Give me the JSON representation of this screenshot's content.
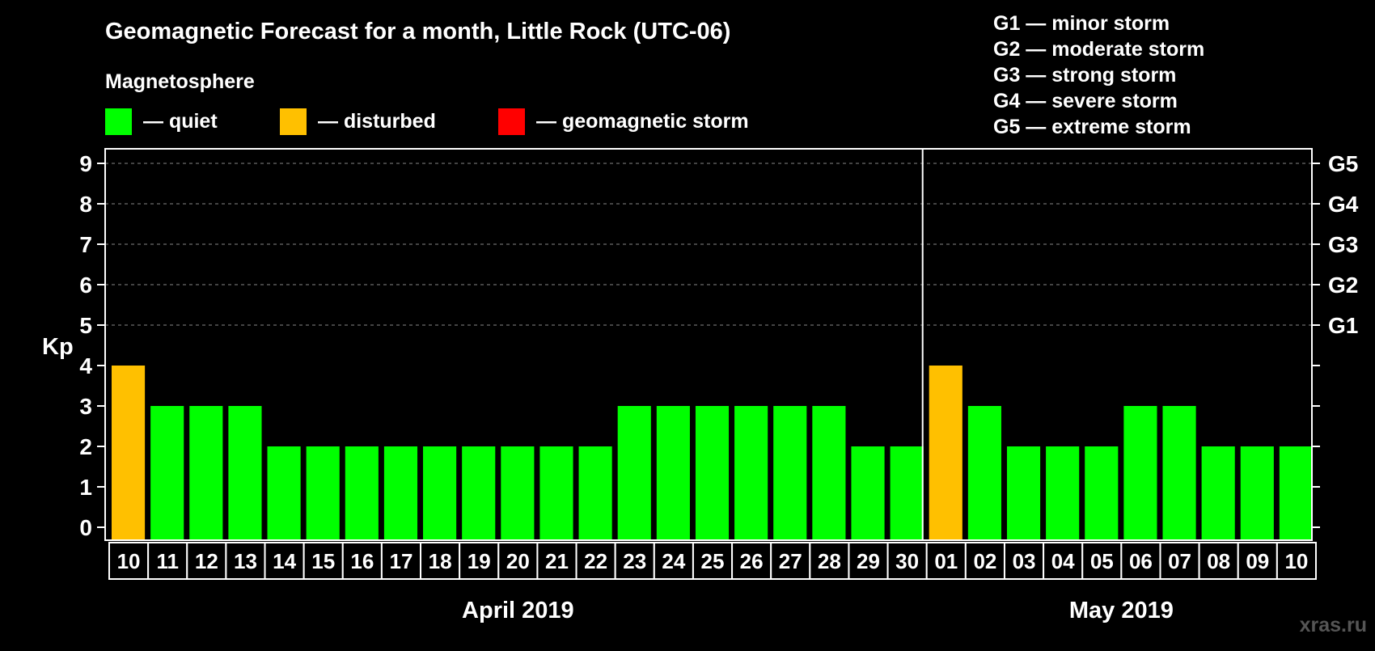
{
  "title": "Geomagnetic Forecast for a month, Little Rock (UTC-06)",
  "legend": {
    "heading": "Magnetosphere",
    "items": [
      {
        "label": "— quiet",
        "color": "#00ff00"
      },
      {
        "label": "— disturbed",
        "color": "#ffc000"
      },
      {
        "label": "— geomagnetic storm",
        "color": "#ff0000"
      }
    ]
  },
  "storm_scale": [
    "G1 — minor storm",
    "G2 — moderate storm",
    "G3 — strong storm",
    "G4 — severe storm",
    "G5 — extreme storm"
  ],
  "watermark": "xras.ru",
  "colors": {
    "background": "#000000",
    "quiet": "#00ff00",
    "disturbed": "#ffc000",
    "storm": "#ff0000",
    "axis": "#ffffff",
    "grid": "#888888"
  },
  "chart_data": {
    "type": "bar",
    "ylabel": "Kp",
    "ylim": [
      0,
      9
    ],
    "yticks": [
      "0",
      "1",
      "2",
      "3",
      "4",
      "5",
      "6",
      "7",
      "8",
      "9"
    ],
    "right_labels": [
      {
        "kp": 5,
        "label": "G1"
      },
      {
        "kp": 6,
        "label": "G2"
      },
      {
        "kp": 7,
        "label": "G3"
      },
      {
        "kp": 8,
        "label": "G4"
      },
      {
        "kp": 9,
        "label": "G5"
      }
    ],
    "grid": "dashed, Kp 5–9",
    "categories": [
      "10",
      "11",
      "12",
      "13",
      "14",
      "15",
      "16",
      "17",
      "18",
      "19",
      "20",
      "21",
      "22",
      "23",
      "24",
      "25",
      "26",
      "27",
      "28",
      "29",
      "30",
      "01",
      "02",
      "03",
      "04",
      "05",
      "06",
      "07",
      "08",
      "09",
      "10"
    ],
    "values": [
      4,
      3,
      3,
      3,
      2,
      2,
      2,
      2,
      2,
      2,
      2,
      2,
      2,
      3,
      3,
      3,
      3,
      3,
      3,
      2,
      2,
      4,
      3,
      2,
      2,
      2,
      3,
      3,
      2,
      2,
      2
    ],
    "status": [
      "disturbed",
      "quiet",
      "quiet",
      "quiet",
      "quiet",
      "quiet",
      "quiet",
      "quiet",
      "quiet",
      "quiet",
      "quiet",
      "quiet",
      "quiet",
      "quiet",
      "quiet",
      "quiet",
      "quiet",
      "quiet",
      "quiet",
      "quiet",
      "quiet",
      "disturbed",
      "quiet",
      "quiet",
      "quiet",
      "quiet",
      "quiet",
      "quiet",
      "quiet",
      "quiet",
      "quiet"
    ],
    "months": [
      {
        "label": "April 2019",
        "count": 21
      },
      {
        "label": "May 2019",
        "count": 10
      }
    ]
  }
}
